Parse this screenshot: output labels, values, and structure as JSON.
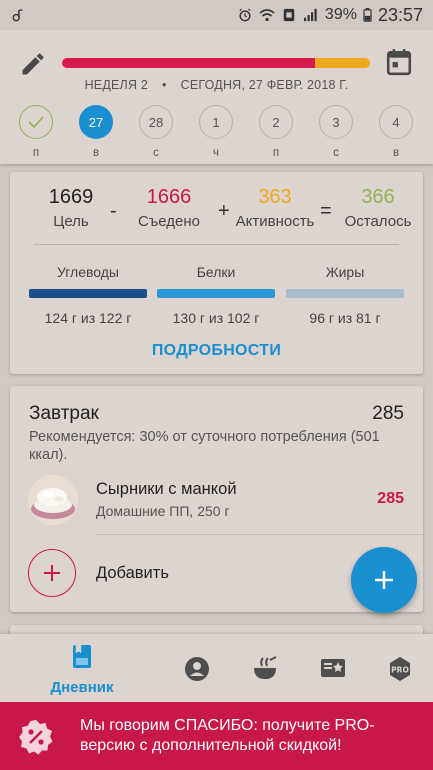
{
  "status_bar": {
    "battery": "39%",
    "time": "23:57"
  },
  "header": {
    "progress": {
      "eaten_fraction": 0.82,
      "activity_fraction": 0.18
    },
    "week_label": "НЕДЕЛЯ 2",
    "separator": "•",
    "today_label": "СЕГОДНЯ, 27 ФЕВР. 2018 Г.",
    "days": [
      {
        "number": "",
        "letter": "п",
        "state": "done"
      },
      {
        "number": "27",
        "letter": "в",
        "state": "today"
      },
      {
        "number": "28",
        "letter": "с",
        "state": "future"
      },
      {
        "number": "1",
        "letter": "ч",
        "state": "future"
      },
      {
        "number": "2",
        "letter": "п",
        "state": "future"
      },
      {
        "number": "3",
        "letter": "с",
        "state": "future"
      },
      {
        "number": "4",
        "letter": "в",
        "state": "future"
      }
    ]
  },
  "summary": {
    "goal": {
      "value": "1669",
      "label": "Цель"
    },
    "minus": "-",
    "eaten": {
      "value": "1666",
      "label": "Съедено"
    },
    "plus": "+",
    "activity": {
      "value": "363",
      "label": "Активность"
    },
    "equals": "=",
    "remaining": {
      "value": "366",
      "label": "Осталось"
    },
    "macros": [
      {
        "name": "Углеводы",
        "value": "124 г из 122 г",
        "color": "#1e4f8c"
      },
      {
        "name": "Белки",
        "value": "130 г из 102 г",
        "color": "#2a9ad6"
      },
      {
        "name": "Жиры",
        "value": "96 г из 81 г",
        "color": "#a9bccb"
      }
    ],
    "details_link": "ПОДРОБНОСТИ"
  },
  "meal": {
    "title": "Завтрак",
    "kcal": "285",
    "recommendation": "Рекомендуется: 30% от суточного потребления (501 ккал).",
    "food": {
      "name": "Сырники с манкой",
      "meta": "Домашние ПП, 250 г",
      "kcal": "285"
    },
    "add_label": "Добавить"
  },
  "bottom_nav": {
    "diary_label": "Дневник"
  },
  "promo": {
    "text": "Мы говорим СПАСИБО: получите PRO-версию с дополнительной скидкой!"
  },
  "colors": {
    "accent": "#1a8fd0",
    "eaten": "#c8184a",
    "activity": "#f0a81c",
    "remaining": "#8fb454"
  }
}
